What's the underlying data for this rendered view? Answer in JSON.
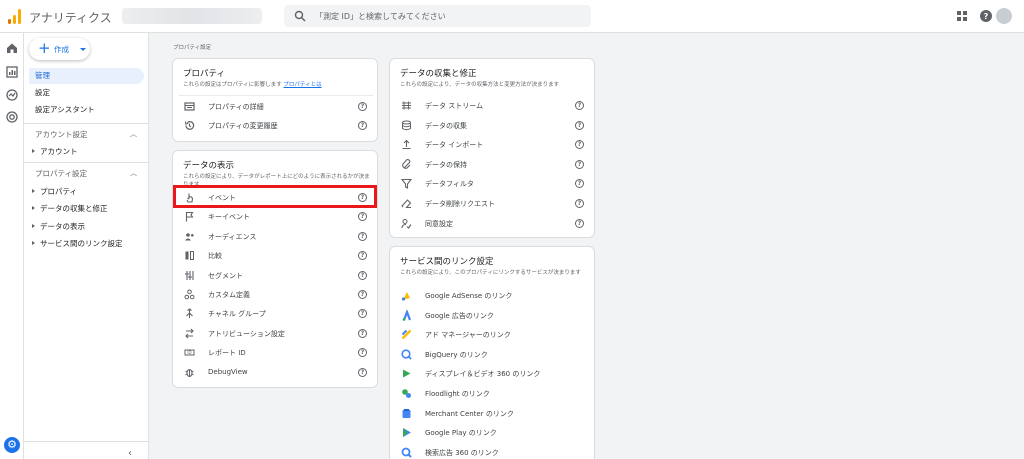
{
  "app": {
    "title": "アナリティクス"
  },
  "search": {
    "placeholder": "「測定 ID」と検索してみてください"
  },
  "nav": {
    "create_label": "作成",
    "items": [
      "管理",
      "設定",
      "設定アシスタント"
    ],
    "account_section": "アカウント設定",
    "account_items": [
      "アカウント"
    ],
    "property_section": "プロパティ設定",
    "property_items": [
      "プロパティ",
      "データの収集と修正",
      "データの表示",
      "サービス間のリンク設定"
    ]
  },
  "breadcrumb": "プロパティ設定",
  "property_card": {
    "title": "プロパティ",
    "desc_prefix": "これらの設定はプロパティに影響します",
    "desc_link": "プロパティとは",
    "rows": [
      {
        "label": "プロパティの詳細",
        "icon": "property-details-icon"
      },
      {
        "label": "プロパティの変更履歴",
        "icon": "history-icon"
      }
    ]
  },
  "display_card": {
    "title": "データの表示",
    "desc": "これらの設定により、データがレポート上にどのように表示されるかが決まります",
    "rows": [
      {
        "label": "イベント",
        "icon": "touch-icon"
      },
      {
        "label": "キーイベント",
        "icon": "flag-icon"
      },
      {
        "label": "オーディエンス",
        "icon": "audience-icon"
      },
      {
        "label": "比較",
        "icon": "compare-icon"
      },
      {
        "label": "セグメント",
        "icon": "segment-icon"
      },
      {
        "label": "カスタム定義",
        "icon": "custom-definitions-icon"
      },
      {
        "label": "チャネル グループ",
        "icon": "channel-group-icon"
      },
      {
        "label": "アトリビューション設定",
        "icon": "attribution-icon"
      },
      {
        "label": "レポート ID",
        "icon": "report-id-icon"
      },
      {
        "label": "DebugView",
        "icon": "debug-icon"
      }
    ]
  },
  "collection_card": {
    "title": "データの収集と修正",
    "desc": "これらの設定により、データの収集方法と変更方法が決まります",
    "rows": [
      {
        "label": "データ ストリーム",
        "icon": "data-stream-icon"
      },
      {
        "label": "データの収集",
        "icon": "database-icon"
      },
      {
        "label": "データ インポート",
        "icon": "upload-icon"
      },
      {
        "label": "データの保持",
        "icon": "retention-icon"
      },
      {
        "label": "データフィルタ",
        "icon": "filter-icon"
      },
      {
        "label": "データ削除リクエスト",
        "icon": "eraser-icon"
      },
      {
        "label": "同意設定",
        "icon": "consent-icon"
      }
    ]
  },
  "links_card": {
    "title": "サービス間のリンク設定",
    "desc": "これらの設定により、このプロパティにリンクするサービスが決まります",
    "rows": [
      {
        "label": "Google AdSense のリンク",
        "icon": "adsense-icon",
        "color": "#fbbc04"
      },
      {
        "label": "Google 広告のリンク",
        "icon": "google-ads-icon",
        "color": "#4285f4"
      },
      {
        "label": "アド マネージャーのリンク",
        "icon": "ad-manager-icon",
        "color": "#fbbc04"
      },
      {
        "label": "BigQuery のリンク",
        "icon": "bigquery-icon",
        "color": "#4285f4"
      },
      {
        "label": "ディスプレイ＆ビデオ 360 のリンク",
        "icon": "dv360-icon",
        "color": "#34a853"
      },
      {
        "label": "Floodlight のリンク",
        "icon": "floodlight-icon",
        "color": "#34a853"
      },
      {
        "label": "Merchant Center のリンク",
        "icon": "merchant-center-icon",
        "color": "#4285f4"
      },
      {
        "label": "Google Play のリンク",
        "icon": "google-play-icon",
        "color": "#4285f4"
      },
      {
        "label": "検索広告 360 のリンク",
        "icon": "search-ads-360-icon",
        "color": "#4285f4"
      }
    ]
  },
  "colors": {
    "accent": "#1a73e8",
    "highlight": "#e8181b",
    "active_bg": "#e8f0fe"
  }
}
